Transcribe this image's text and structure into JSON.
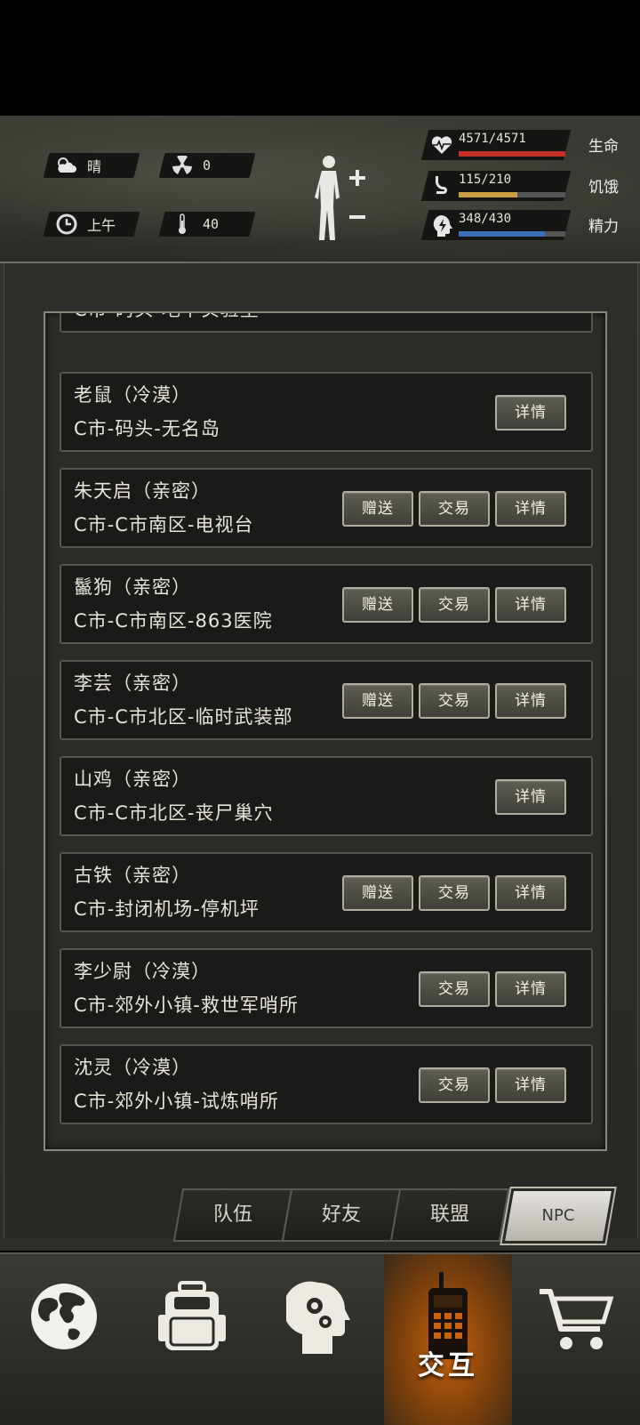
{
  "status": {
    "weather": "晴",
    "radiation": "0",
    "time_of_day": "上午",
    "temperature": "40",
    "life": {
      "value": "4571/4571",
      "label": "生命",
      "fraction": 1.0,
      "color": "#c4302b"
    },
    "hunger": {
      "value": "115/210",
      "label": "饥饿",
      "fraction": 0.5476,
      "color": "#c9a046"
    },
    "energy": {
      "value": "348/430",
      "label": "精力",
      "fraction": 0.8093,
      "color": "#3d6fb6"
    },
    "icons": [
      "weather-cloud-sun-icon",
      "radiation-icon",
      "clock-icon",
      "thermometer-icon",
      "body-status-icon",
      "heart-rate-icon",
      "stomach-icon",
      "brain-energy-icon"
    ]
  },
  "npcs": [
    {
      "name": "",
      "location": "C市-码头-地下实验室",
      "buttons": [
        "",
        "",
        ""
      ]
    },
    {
      "name": "老鼠（冷漠）",
      "location": "C市-码头-无名岛",
      "buttons": [
        "详情"
      ]
    },
    {
      "name": "朱天启（亲密）",
      "location": "C市-C市南区-电视台",
      "buttons": [
        "赠送",
        "交易",
        "详情"
      ]
    },
    {
      "name": "鬣狗（亲密）",
      "location": "C市-C市南区-863医院",
      "buttons": [
        "赠送",
        "交易",
        "详情"
      ]
    },
    {
      "name": "李芸（亲密）",
      "location": "C市-C市北区-临时武装部",
      "buttons": [
        "赠送",
        "交易",
        "详情"
      ]
    },
    {
      "name": "山鸡（亲密）",
      "location": "C市-C市北区-丧尸巢穴",
      "buttons": [
        "详情"
      ]
    },
    {
      "name": "古铁（亲密）",
      "location": "C市-封闭机场-停机坪",
      "buttons": [
        "赠送",
        "交易",
        "详情"
      ]
    },
    {
      "name": "李少尉（冷漠）",
      "location": "C市-郊外小镇-救世军哨所",
      "buttons": [
        "交易",
        "详情"
      ]
    },
    {
      "name": "沈灵（冷漠）",
      "location": "C市-郊外小镇-试炼哨所",
      "buttons": [
        "交易",
        "详情"
      ]
    }
  ],
  "tabs": [
    {
      "label": "队伍",
      "active": false
    },
    {
      "label": "好友",
      "active": false
    },
    {
      "label": "联盟",
      "active": false
    },
    {
      "label": "NPC",
      "active": true
    }
  ],
  "nav": [
    {
      "icon": "globe-icon",
      "label": "",
      "active": false
    },
    {
      "icon": "backpack-icon",
      "label": "",
      "active": false
    },
    {
      "icon": "head-gears-icon",
      "label": "",
      "active": false
    },
    {
      "icon": "walkie-talkie-icon",
      "label": "交互",
      "active": true
    },
    {
      "icon": "shopping-cart-icon",
      "label": "",
      "active": false
    }
  ]
}
